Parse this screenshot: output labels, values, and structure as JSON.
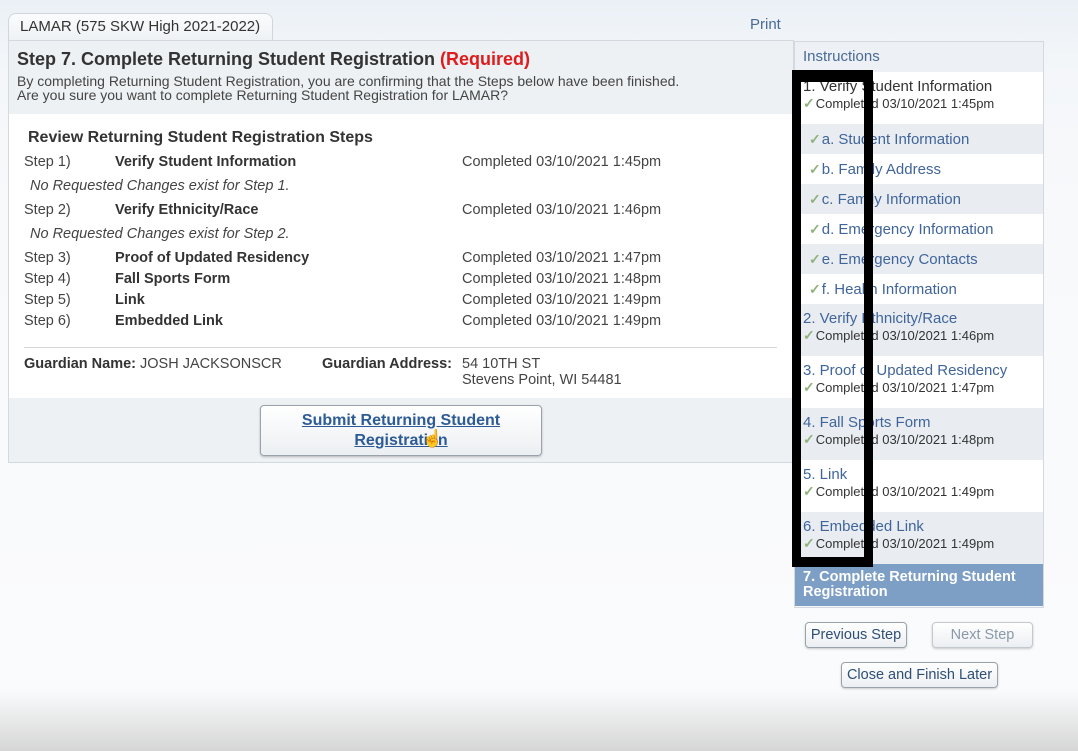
{
  "tab": {
    "label": "LAMAR (575 SKW High 2021-2022)"
  },
  "print_label": "Print",
  "main": {
    "title": "Step 7. Complete Returning Student Registration",
    "required": "(Required)",
    "desc_line1": "By completing Returning Student Registration, you are confirming that the Steps below have been finished.",
    "desc_line2": "Are you sure you want to complete Returning Student Registration for LAMAR?",
    "review_title": "Review Returning Student Registration Steps",
    "steps": [
      {
        "num": "Step 1)",
        "name": "Verify Student Information",
        "status": "Completed 03/10/2021 1:45pm",
        "note": "No Requested Changes exist for Step 1."
      },
      {
        "num": "Step 2)",
        "name": "Verify Ethnicity/Race",
        "status": "Completed 03/10/2021 1:46pm",
        "note": "No Requested Changes exist for Step 2."
      },
      {
        "num": "Step 3)",
        "name": "Proof of Updated Residency",
        "status": "Completed 03/10/2021 1:47pm"
      },
      {
        "num": "Step 4)",
        "name": "Fall Sports Form",
        "status": "Completed 03/10/2021 1:48pm"
      },
      {
        "num": "Step 5)",
        "name": "Link",
        "status": "Completed 03/10/2021 1:49pm"
      },
      {
        "num": "Step 6)",
        "name": "Embedded Link",
        "status": "Completed 03/10/2021 1:49pm"
      }
    ],
    "guardian_name_label": "Guardian Name:",
    "guardian_name": "JOSH JACKSONSCR",
    "guardian_address_label": "Guardian Address:",
    "guardian_address_line1": "54 10TH ST",
    "guardian_address_line2": "Stevens Point, WI 54481",
    "submit_line1": "Submit Returning Student",
    "submit_line2": "Registration"
  },
  "sidebar": {
    "header": "Instructions",
    "check_glyph": "✓",
    "items": [
      {
        "label": "1. Verify Student Information",
        "done": "Completed 03/10/2021 1:45pm"
      },
      {
        "sub": "a. Student Information"
      },
      {
        "sub": "b. Family Address"
      },
      {
        "sub": "c. Family Information"
      },
      {
        "sub": "d. Emergency Information"
      },
      {
        "sub": "e. Emergency Contacts"
      },
      {
        "sub": "f. Health Information"
      },
      {
        "label": "2. Verify Ethnicity/Race",
        "done": "Completed 03/10/2021 1:46pm"
      },
      {
        "label": "3. Proof of Updated Residency",
        "done": "Completed 03/10/2021 1:47pm"
      },
      {
        "label": "4. Fall Sports Form",
        "done": "Completed 03/10/2021 1:48pm"
      },
      {
        "label": "5. Link",
        "done": "Completed 03/10/2021 1:49pm"
      },
      {
        "label": "6. Embedded Link",
        "done": "Completed 03/10/2021 1:49pm"
      }
    ],
    "active_line1": "7. Complete Returning Student",
    "active_line2": "Registration",
    "prev_label": "Previous Step",
    "next_label": "Next Step",
    "close_label": "Close and Finish Later"
  },
  "cursor_glyph": "☝"
}
